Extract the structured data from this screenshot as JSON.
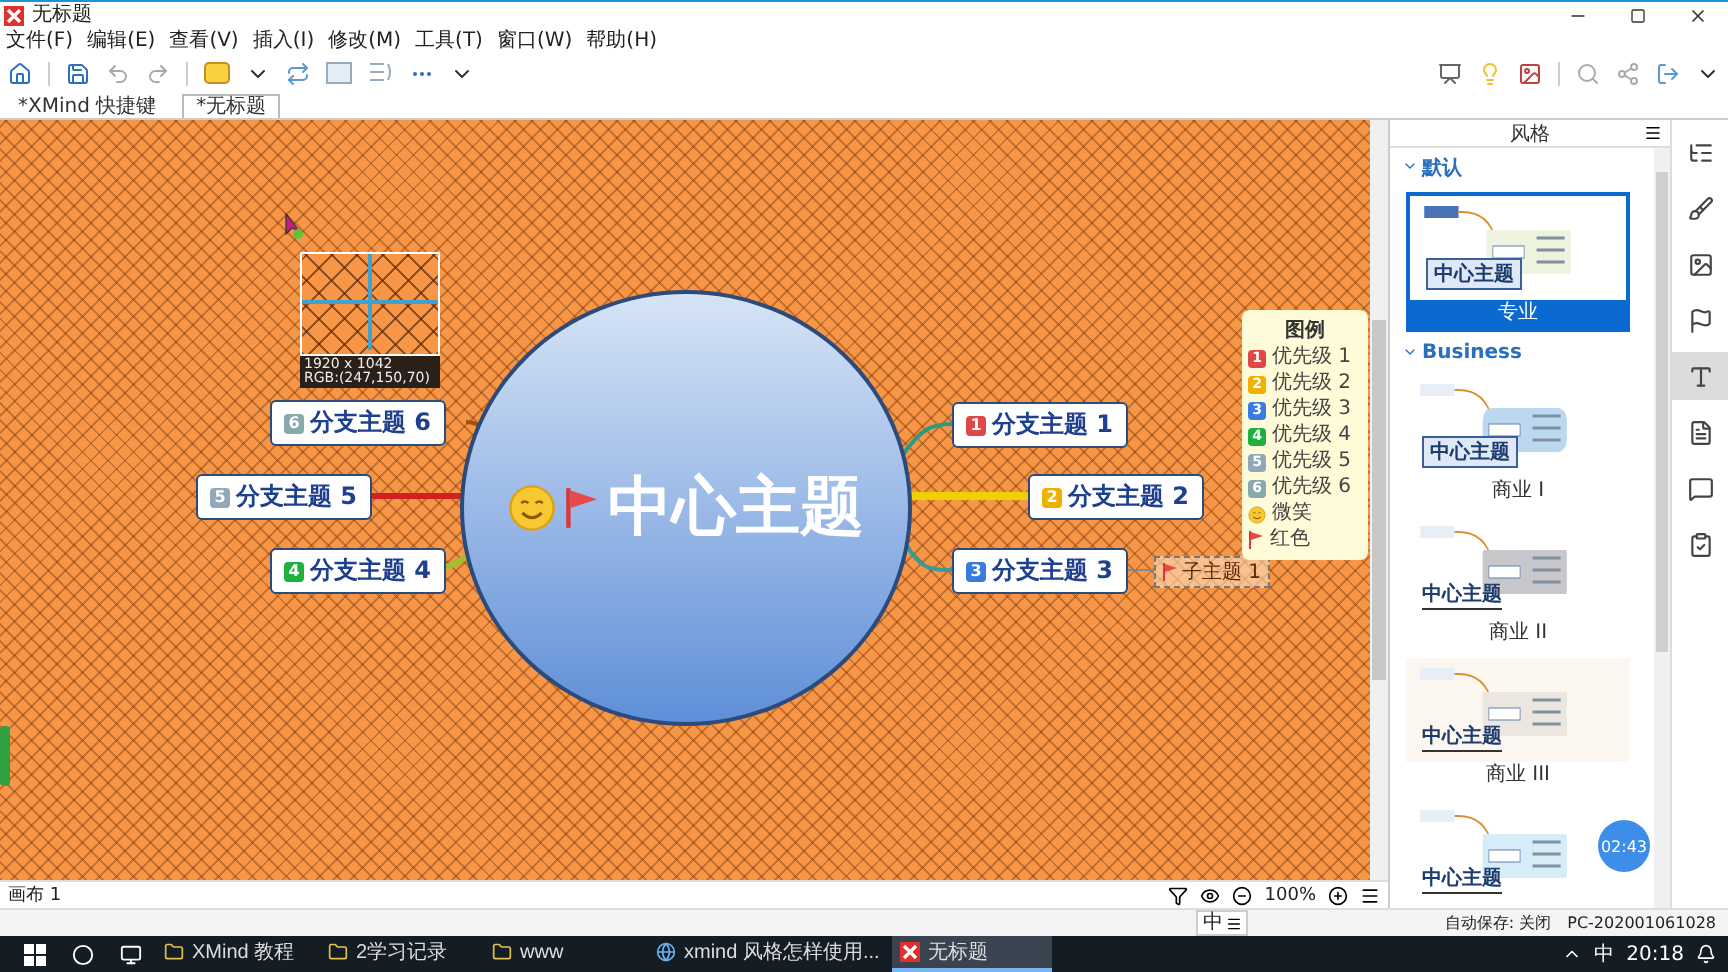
{
  "window": {
    "title": "无标题"
  },
  "menu": [
    "文件(F)",
    "编辑(E)",
    "查看(V)",
    "插入(I)",
    "修改(M)",
    "工具(T)",
    "窗口(W)",
    "帮助(H)"
  ],
  "tabs": [
    {
      "label": "*XMind 快捷键",
      "selected": false
    },
    {
      "label": "*无标题",
      "selected": true
    }
  ],
  "map": {
    "central": "中心主题",
    "branches": [
      {
        "label": "分支主题 6",
        "priority": "6",
        "color": "#88a8b0"
      },
      {
        "label": "分支主题 1",
        "priority": "1",
        "color": "#e04848"
      },
      {
        "label": "分支主题 5",
        "priority": "5",
        "color": "#90a8b8"
      },
      {
        "label": "分支主题 2",
        "priority": "2",
        "color": "#f0b000"
      },
      {
        "label": "分支主题 4",
        "priority": "4",
        "color": "#20b040"
      },
      {
        "label": "分支主题 3",
        "priority": "3",
        "color": "#3a7be0"
      }
    ],
    "subtopic": {
      "label": "子主题 1"
    }
  },
  "legend": {
    "title": "图例",
    "items": [
      {
        "kind": "priority",
        "number": "1",
        "label": "优先级 1",
        "color": "#e04848"
      },
      {
        "kind": "priority",
        "number": "2",
        "label": "优先级 2",
        "color": "#f0b000"
      },
      {
        "kind": "priority",
        "number": "3",
        "label": "优先级 3",
        "color": "#3a7be0"
      },
      {
        "kind": "priority",
        "number": "4",
        "label": "优先级 4",
        "color": "#20b040"
      },
      {
        "kind": "priority",
        "number": "5",
        "label": "优先级 5",
        "color": "#90a8b8"
      },
      {
        "kind": "priority",
        "number": "6",
        "label": "优先级 6",
        "color": "#88a8b0"
      },
      {
        "kind": "smiley",
        "label": "微笑"
      },
      {
        "kind": "flag",
        "label": "红色"
      }
    ]
  },
  "magnifier": {
    "size": "1920 x 1042",
    "rgb": "RGB:(247,150,70)"
  },
  "canvas_footer": {
    "sheet": "画布 1",
    "zoom": "100%"
  },
  "style_panel": {
    "title": "风格",
    "groups": [
      {
        "name": "默认",
        "expanded": true,
        "styles": [
          {
            "kind": "pro",
            "name": "专业",
            "center": "中心主题",
            "selected": true
          }
        ]
      },
      {
        "name": "Business",
        "expanded": true,
        "styles": [
          {
            "kind": "cloud",
            "name": "商业 I",
            "center": "中心主题",
            "selected": false
          },
          {
            "kind": "grey",
            "name": "商业 II",
            "center": "中心主题",
            "selected": false
          },
          {
            "kind": "beige",
            "name": "商业 III",
            "center": "中心主题",
            "selected": false
          },
          {
            "kind": "blue",
            "center": "中心主题",
            "selected": false
          }
        ]
      }
    ]
  },
  "timer": "02:43",
  "side_tabs": [
    {
      "kind": "outline",
      "selected": false
    },
    {
      "kind": "brush",
      "selected": false
    },
    {
      "kind": "image",
      "selected": false
    },
    {
      "kind": "flag",
      "selected": false
    },
    {
      "kind": "style",
      "selected": true
    },
    {
      "kind": "note",
      "selected": false
    },
    {
      "kind": "comment",
      "selected": false
    },
    {
      "kind": "task",
      "selected": false
    }
  ],
  "status_bar": {
    "ime": "中",
    "autosave": "自动保存: 关闭",
    "user": "PC-202001061028"
  },
  "taskbar": {
    "items": [
      {
        "kind": "folder",
        "label": "XMind 教程",
        "selected": false
      },
      {
        "kind": "folder",
        "label": "2学习记录",
        "selected": false
      },
      {
        "kind": "folder",
        "label": "www",
        "selected": false
      },
      {
        "kind": "browser",
        "label": "xmind 风格怎样使用...",
        "selected": false
      },
      {
        "kind": "xmind",
        "label": "无标题",
        "selected": true
      }
    ],
    "ime": "中",
    "clock": "20:18"
  }
}
